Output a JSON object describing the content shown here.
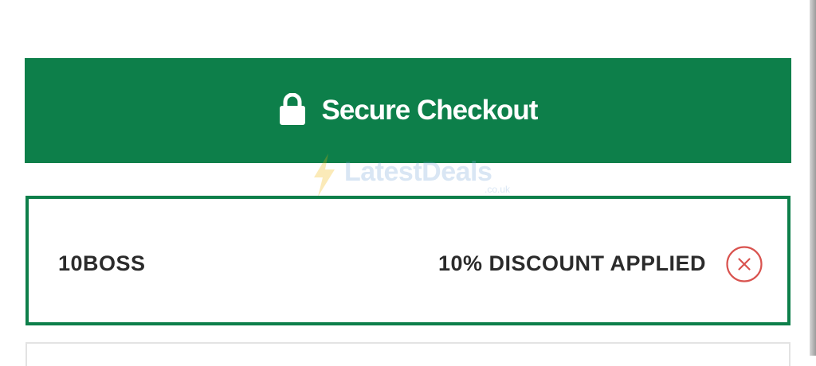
{
  "colors": {
    "brand_green": "#0d7f4a",
    "remove_red": "#d9534f"
  },
  "checkout": {
    "icon": "lock-icon",
    "label": "Secure Checkout"
  },
  "watermark": {
    "text": "LatestDeals",
    "tld": ".co.uk"
  },
  "coupon": {
    "code": "10BOSS",
    "status": "10% DISCOUNT APPLIED",
    "remove_icon": "close-circle-icon"
  }
}
